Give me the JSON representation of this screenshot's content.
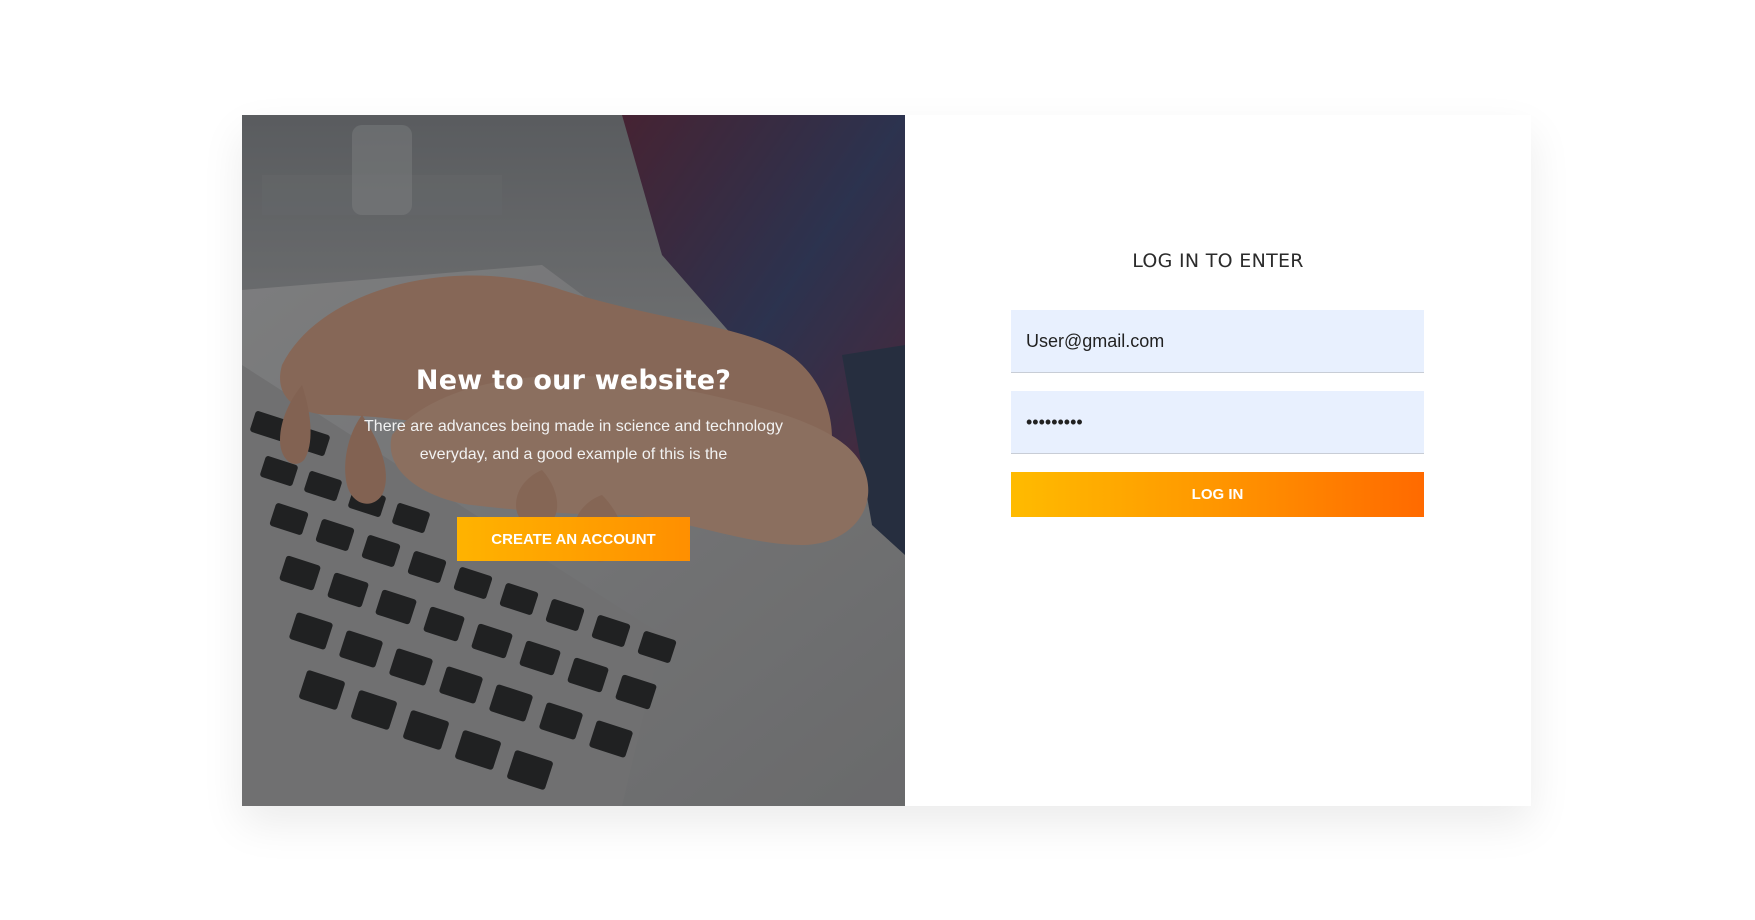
{
  "promo": {
    "title": "New to our website?",
    "text": "There are advances being made in science and technology everyday, and a good example of this is the",
    "button_label": "CREATE AN ACCOUNT",
    "background_image": "hands-typing-on-laptop-photo"
  },
  "login": {
    "title": "LOG IN TO ENTER",
    "email_value": "User@gmail.com",
    "password_value": "•••••••••",
    "button_label": "LOG IN"
  },
  "colors": {
    "accent_start": "#ffbb00",
    "accent_end": "#ff6a00",
    "input_bg": "#e8f0fe"
  }
}
